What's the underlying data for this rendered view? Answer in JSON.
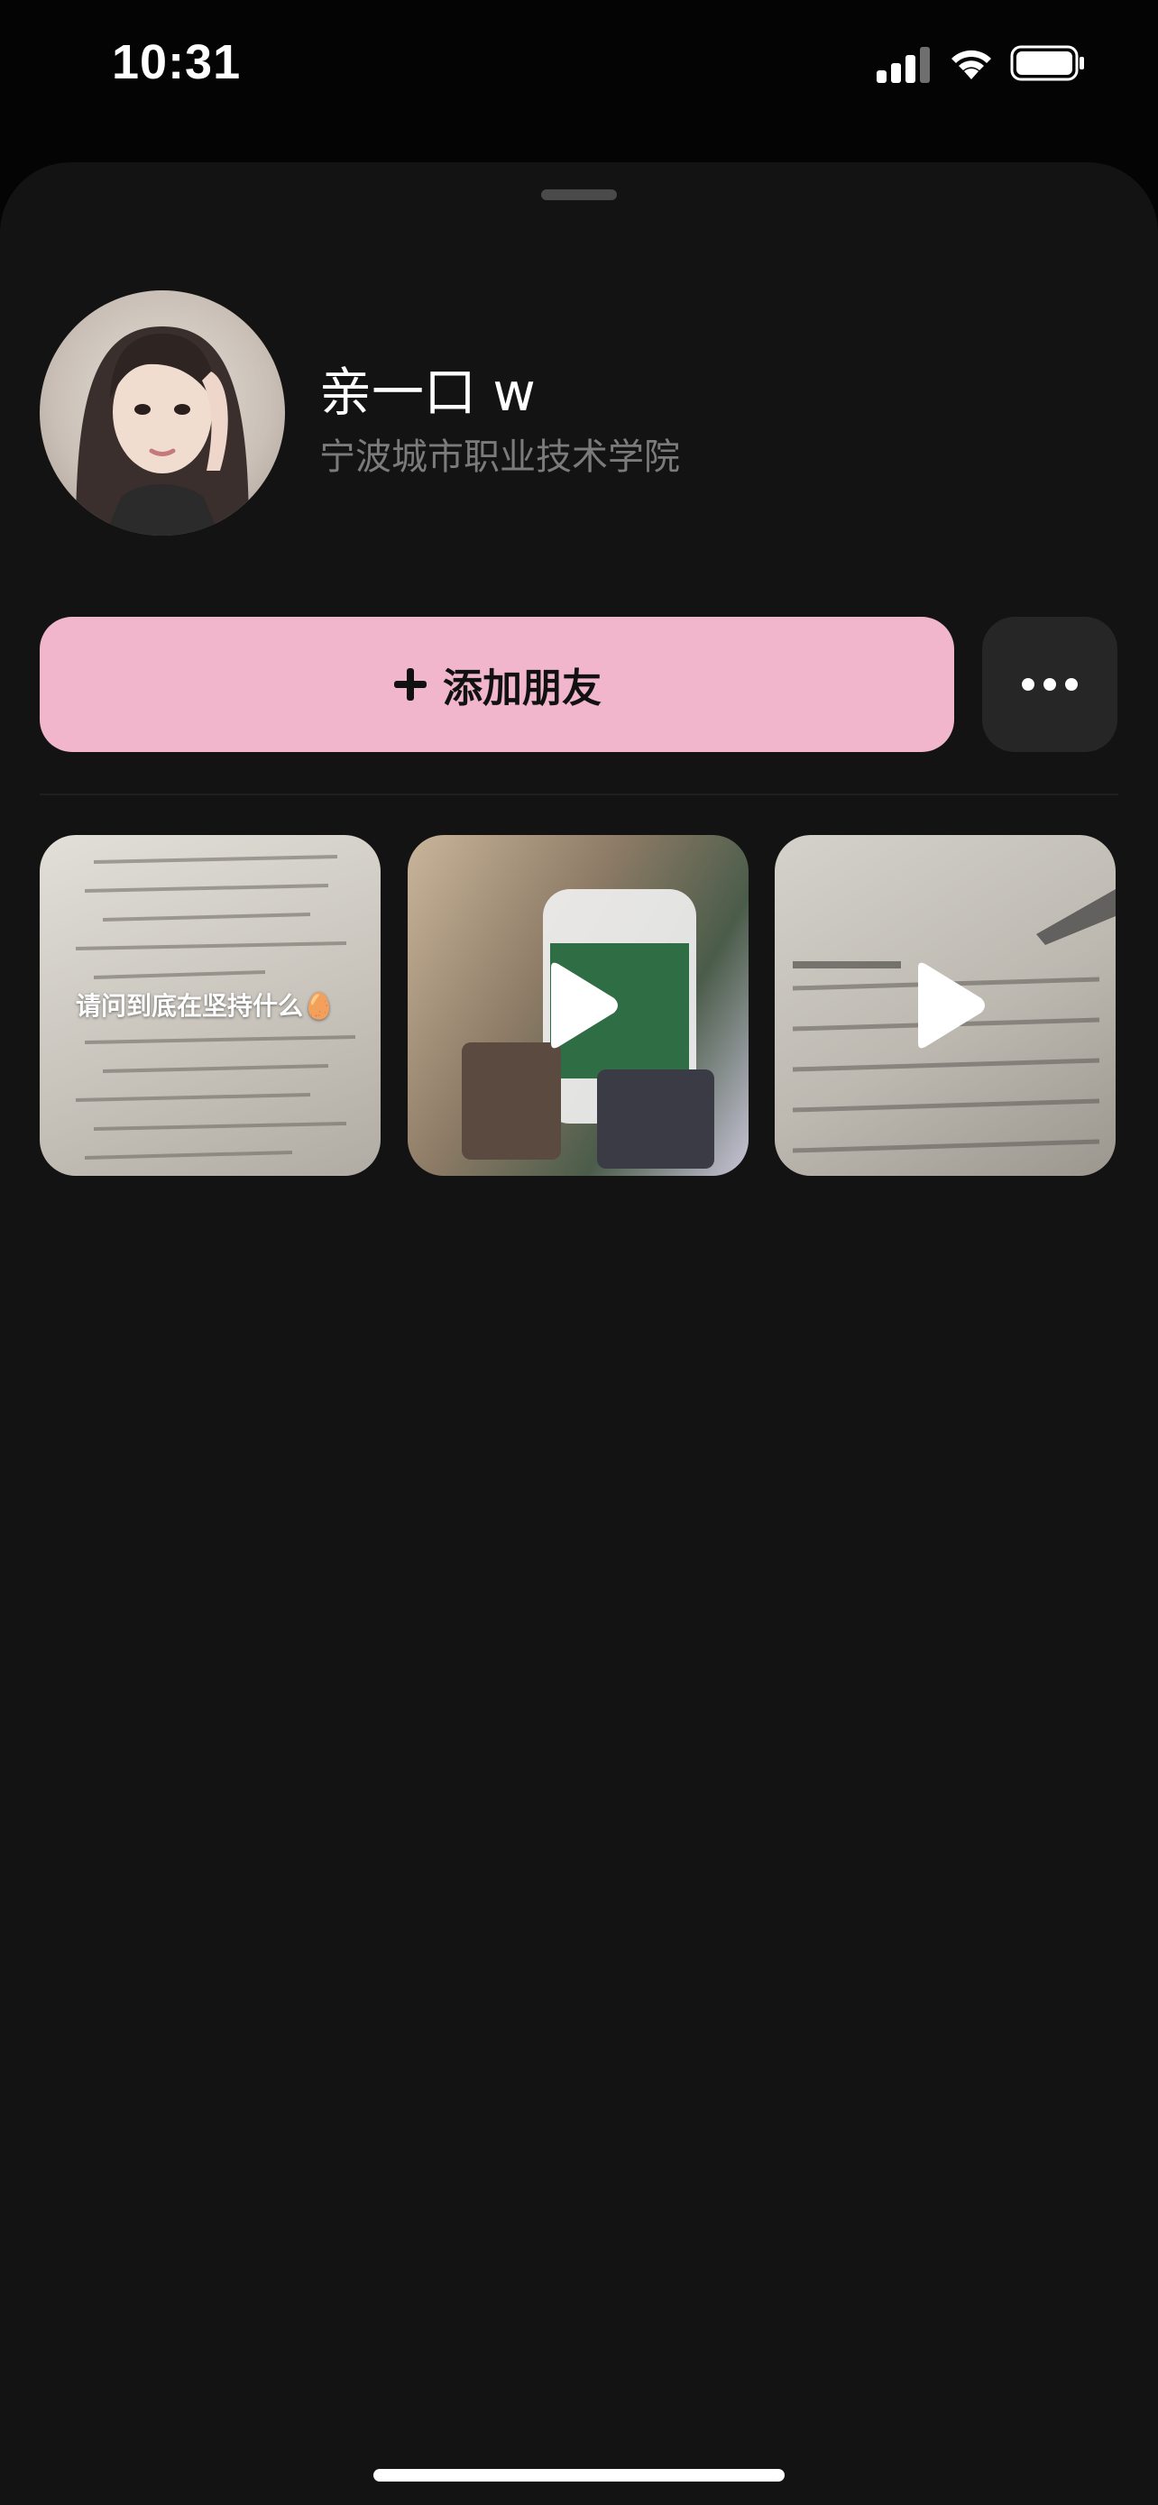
{
  "status_bar": {
    "time": "10:31",
    "icons": [
      "cellular-signal-icon",
      "wifi-icon",
      "battery-icon"
    ]
  },
  "profile": {
    "name": "亲一口 w",
    "school": "宁波城市职业技术学院",
    "avatar_icon": "user-avatar-photo"
  },
  "actions": {
    "add_friend_label": "添加朋友",
    "add_friend_icon": "plus-icon",
    "more_icon": "ellipsis-icon"
  },
  "posts": [
    {
      "type": "photo",
      "caption": "请问到底在坚持什么🥚"
    },
    {
      "type": "video",
      "play_icon": "play-icon"
    },
    {
      "type": "video",
      "play_icon": "play-icon"
    }
  ],
  "colors": {
    "background": "#131313",
    "accent_pink": "#f1b6cb",
    "secondary_text": "#7b7b7b",
    "more_button_bg": "#262626"
  }
}
